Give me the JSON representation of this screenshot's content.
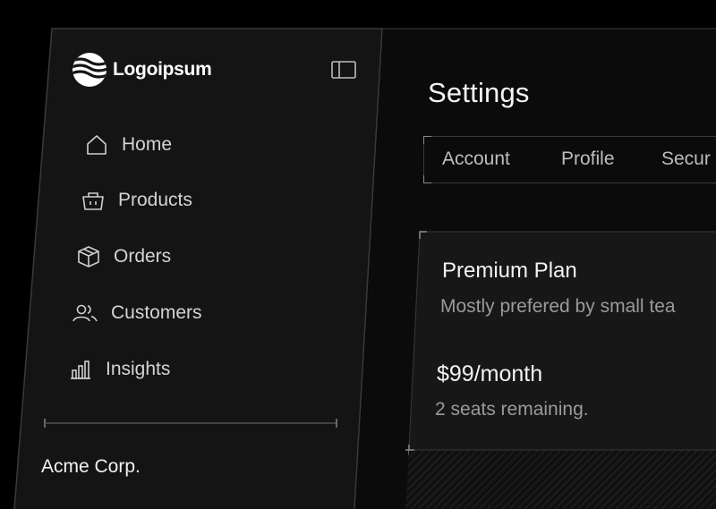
{
  "brand": {
    "name": "Logoipsum",
    "logo_icon": "logo-mark-icon"
  },
  "sidebar": {
    "toggle_icon": "sidebar-toggle-icon",
    "items": [
      {
        "label": "Home",
        "icon": "home-icon"
      },
      {
        "label": "Products",
        "icon": "basket-icon"
      },
      {
        "label": "Orders",
        "icon": "package-icon"
      },
      {
        "label": "Customers",
        "icon": "users-icon"
      },
      {
        "label": "Insights",
        "icon": "bar-chart-icon"
      }
    ],
    "company": "Acme Corp."
  },
  "main": {
    "title": "Settings",
    "tabs": [
      {
        "label": "Account"
      },
      {
        "label": "Profile"
      },
      {
        "label": "Secur"
      }
    ],
    "plan": {
      "title": "Premium Plan",
      "description": "Mostly prefered by small tea",
      "price": "$99/month",
      "seats": "2 seats remaining."
    }
  },
  "colors": {
    "background": "#000000",
    "sidebar": "#141414",
    "main": "#0b0b0b",
    "card": "#171717",
    "text_primary": "#f3f3f3",
    "text_muted": "#9a9a9a",
    "border": "#3a3a3a"
  }
}
